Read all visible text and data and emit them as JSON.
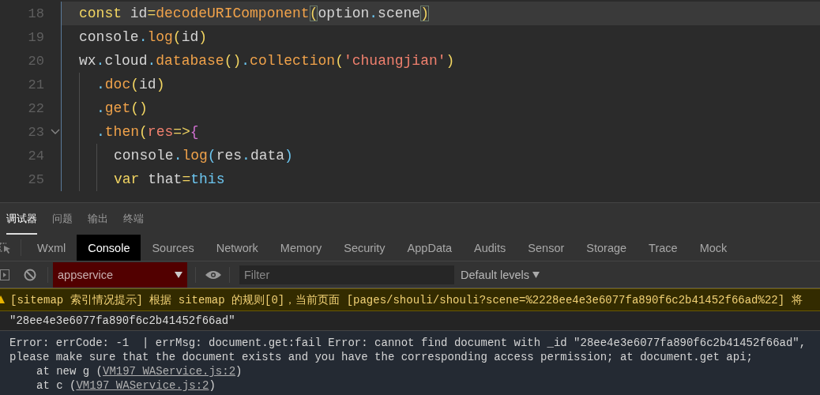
{
  "editor": {
    "lines": [
      {
        "number": "18",
        "current": true,
        "foldable": false,
        "tokens": [
          {
            "kind": "keyword",
            "text": "const"
          },
          {
            "kind": "plain",
            "text": " id"
          },
          {
            "kind": "operator",
            "text": "="
          },
          {
            "kind": "function",
            "text": "decodeURIComponent"
          },
          {
            "kind": "match",
            "text": "("
          },
          {
            "kind": "plain",
            "text": "option"
          },
          {
            "kind": "dot",
            "text": "."
          },
          {
            "kind": "plain",
            "text": "scene"
          },
          {
            "kind": "match",
            "text": ")"
          }
        ]
      },
      {
        "number": "19",
        "current": false,
        "foldable": false,
        "tokens": [
          {
            "kind": "plain",
            "text": "console"
          },
          {
            "kind": "dot",
            "text": "."
          },
          {
            "kind": "function",
            "text": "log"
          },
          {
            "kind": "paren",
            "text": "("
          },
          {
            "kind": "plain",
            "text": "id"
          },
          {
            "kind": "paren",
            "text": ")"
          }
        ]
      },
      {
        "number": "20",
        "current": false,
        "foldable": false,
        "tokens": [
          {
            "kind": "plain",
            "text": "wx"
          },
          {
            "kind": "dot",
            "text": "."
          },
          {
            "kind": "plain",
            "text": "cloud"
          },
          {
            "kind": "dot",
            "text": "."
          },
          {
            "kind": "function",
            "text": "database"
          },
          {
            "kind": "paren",
            "text": "()"
          },
          {
            "kind": "dot",
            "text": "."
          },
          {
            "kind": "function",
            "text": "collection"
          },
          {
            "kind": "paren",
            "text": "("
          },
          {
            "kind": "string",
            "text": "'chuangjian'"
          },
          {
            "kind": "paren",
            "text": ")"
          }
        ],
        "children": [
          {
            "number": "21",
            "current": false,
            "foldable": false,
            "tokens": [
              {
                "kind": "dot",
                "text": "."
              },
              {
                "kind": "function",
                "text": "doc"
              },
              {
                "kind": "paren",
                "text": "("
              },
              {
                "kind": "plain",
                "text": "id"
              },
              {
                "kind": "paren",
                "text": ")"
              }
            ]
          },
          {
            "number": "22",
            "current": false,
            "foldable": false,
            "tokens": [
              {
                "kind": "dot",
                "text": "."
              },
              {
                "kind": "function",
                "text": "get"
              },
              {
                "kind": "paren",
                "text": "()"
              }
            ]
          },
          {
            "number": "23",
            "current": false,
            "foldable": true,
            "tokens": [
              {
                "kind": "dot",
                "text": "."
              },
              {
                "kind": "function",
                "text": "then"
              },
              {
                "kind": "paren",
                "text": "("
              },
              {
                "kind": "string",
                "text": "res"
              },
              {
                "kind": "operator",
                "text": "=>"
              },
              {
                "kind": "brace",
                "text": "{"
              }
            ],
            "children": [
              {
                "number": "24",
                "current": false,
                "foldable": false,
                "tokens": [
                  {
                    "kind": "plain",
                    "text": "console"
                  },
                  {
                    "kind": "dot",
                    "text": "."
                  },
                  {
                    "kind": "function",
                    "text": "log"
                  },
                  {
                    "kind": "inner",
                    "text": "("
                  },
                  {
                    "kind": "plain",
                    "text": "res"
                  },
                  {
                    "kind": "dot",
                    "text": "."
                  },
                  {
                    "kind": "plain",
                    "text": "data"
                  },
                  {
                    "kind": "inner",
                    "text": ")"
                  }
                ]
              },
              {
                "number": "25",
                "current": false,
                "foldable": false,
                "tokens": [
                  {
                    "kind": "keyword",
                    "text": "var"
                  },
                  {
                    "kind": "plain",
                    "text": " that"
                  },
                  {
                    "kind": "operator",
                    "text": "="
                  },
                  {
                    "kind": "this",
                    "text": "this"
                  }
                ]
              }
            ]
          }
        ]
      }
    ]
  },
  "panel_tabs": [
    {
      "label": "调试器",
      "selected": true
    },
    {
      "label": "问题",
      "selected": false
    },
    {
      "label": "输出",
      "selected": false
    },
    {
      "label": "终端",
      "selected": false
    }
  ],
  "devtools_tabs": [
    {
      "label": "Wxml",
      "selected": false
    },
    {
      "label": "Console",
      "selected": true
    },
    {
      "label": "Sources",
      "selected": false
    },
    {
      "label": "Network",
      "selected": false
    },
    {
      "label": "Memory",
      "selected": false
    },
    {
      "label": "Security",
      "selected": false
    },
    {
      "label": "AppData",
      "selected": false
    },
    {
      "label": "Audits",
      "selected": false
    },
    {
      "label": "Sensor",
      "selected": false
    },
    {
      "label": "Storage",
      "selected": false
    },
    {
      "label": "Trace",
      "selected": false
    },
    {
      "label": "Mock",
      "selected": false
    }
  ],
  "toolbar": {
    "context": "appservice",
    "filter": {
      "placeholder": "Filter"
    },
    "levels": "Default levels"
  },
  "messages": [
    {
      "kind": "warning",
      "text": "[sitemap 索引情况提示] 根据 sitemap 的规则[0]，当前页面 [pages/shouli/shouli?scene=%2228ee4e3e6077fa890f6c2b41452f66ad%22] 将"
    },
    {
      "kind": "log",
      "text": "\"28ee4e3e6077fa890f6c2b41452f66ad\""
    },
    {
      "kind": "error",
      "text": "Error: errCode: -1  | errMsg: document.get:fail Error: cannot find document with _id \"28ee4e3e6077fa890f6c2b41452f66ad\",\nplease make sure that the document exists and you have the corresponding access permission; at document.get api;",
      "stack": [
        {
          "prefix": "at new g (",
          "link": "VM197_WAService.js:2",
          "suffix": ")"
        },
        {
          "prefix": "at c (",
          "link": "VM197_WAService.js:2",
          "suffix": ")"
        }
      ]
    }
  ]
}
